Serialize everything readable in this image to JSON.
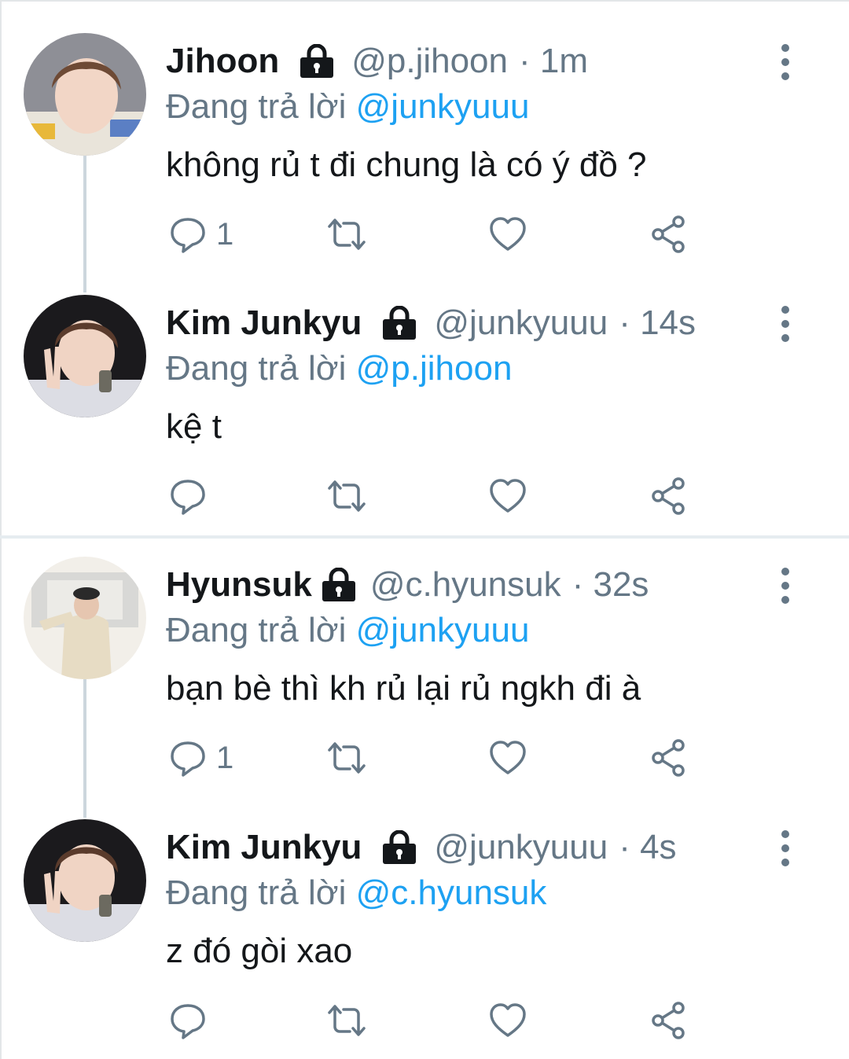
{
  "replying_prefix": "Đang trả lời",
  "colors": {
    "accent": "#1da1f2",
    "muted": "#657786",
    "text": "#14171a",
    "thread_line": "#ccd6dd"
  },
  "tweets": [
    {
      "name": "Jihoon",
      "handle": "@p.jihoon",
      "time": "· 1m",
      "reply_to": "@junkyuuu",
      "text": "không rủ t đi chung là có ý đồ ?",
      "reply_count": "1",
      "icons": [
        "lock-icon",
        "more-icon",
        "reply-icon",
        "retweet-icon",
        "like-icon",
        "share-icon"
      ]
    },
    {
      "name": "Kim Junkyu",
      "handle": "@junkyuuu",
      "time": "· 14s",
      "reply_to": "@p.jihoon",
      "text": "kệ t",
      "reply_count": ""
    },
    {
      "name": "Hyunsuk",
      "handle": "@c.hyunsuk",
      "time": "· 32s",
      "reply_to": "@junkyuuu",
      "text": "bạn bè thì kh rủ lại rủ ngkh đi à",
      "reply_count": "1"
    },
    {
      "name": "Kim Junkyu",
      "handle": "@junkyuuu",
      "time": "· 4s",
      "reply_to": "@c.hyunsuk",
      "text": "z đó gòi xao",
      "reply_count": ""
    }
  ]
}
